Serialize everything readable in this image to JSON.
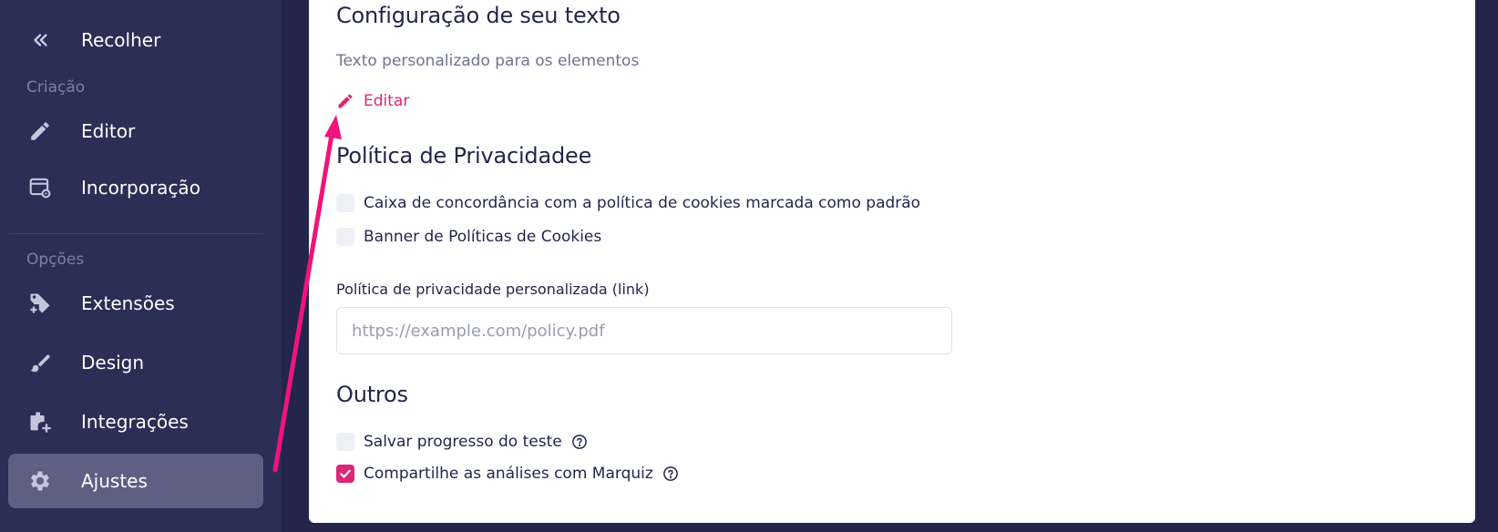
{
  "sidebar": {
    "collapse_label": "Recolher",
    "section_creation": "Criação",
    "editor_label": "Editor",
    "embed_label": "Incorporação",
    "section_options": "Opções",
    "extensions_label": "Extensões",
    "design_label": "Design",
    "integrations_label": "Integrações",
    "settings_label": "Ajustes"
  },
  "main": {
    "text_config_title": "Configuração de seu texto",
    "text_config_subtitle": "Texto personalizado para os elementos",
    "edit_label": "Editar",
    "privacy_title": "Política de Privacidadee",
    "cookie_checkbox_label": "Caixa de concordância com a política de cookies marcada como padrão",
    "cookie_checkbox_checked": false,
    "banner_checkbox_label": "Banner de Políticas de Cookies",
    "banner_checkbox_checked": false,
    "privacy_link_label": "Política de privacidade personalizada (link)",
    "privacy_link_value": "",
    "privacy_link_placeholder": "https://example.com/policy.pdf",
    "others_title": "Outros",
    "save_progress_label": "Salvar progresso do teste",
    "save_progress_checked": false,
    "share_analytics_label": "Compartilhe as análises com Marquiz",
    "share_analytics_checked": true
  },
  "colors": {
    "sidebar_bg": "#2b2e55",
    "active_item_bg": "#5d6083",
    "accent": "#db2777",
    "annotation_arrow": "#f0147a"
  },
  "icons": {
    "collapse": "chevrons-left-icon",
    "editor": "pencil-icon",
    "embed": "embed-window-gear-icon",
    "extensions": "puzzle-plus-icon",
    "design": "brush-icon",
    "integrations": "plugin-plus-icon",
    "settings": "gear-icon",
    "edit": "pencil-icon",
    "help": "question-circle-icon",
    "check": "checkmark-icon"
  }
}
